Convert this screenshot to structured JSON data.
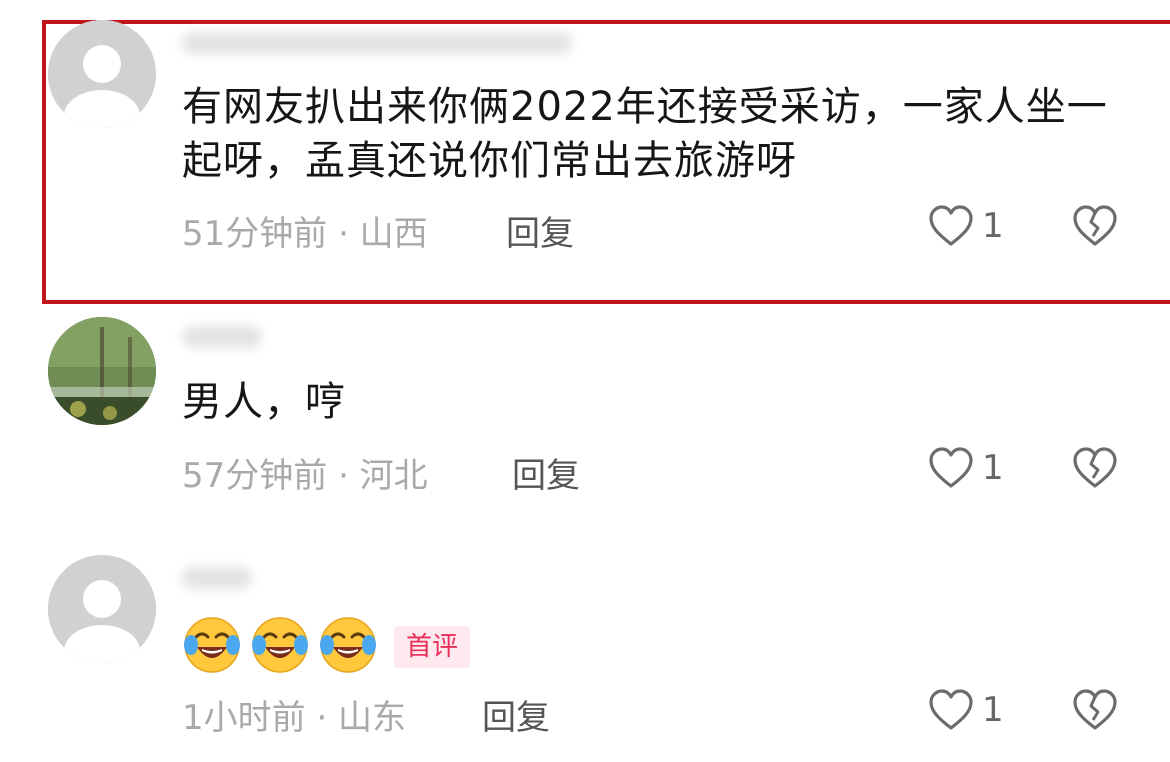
{
  "comments": [
    {
      "text": "有网友扒出来你俩2022年还接受采访，一家人坐一起呀，孟真还说你们常出去旅游呀",
      "time_location": "51分钟前 · 山西",
      "reply_label": "回复",
      "likes": "1",
      "avatar_icon": "default-avatar-icon"
    },
    {
      "text": "男人，哼",
      "time_location": "57分钟前 · 河北",
      "reply_label": "回复",
      "likes": "1",
      "avatar_icon": "photo-avatar"
    },
    {
      "emojis": [
        "face-with-tears-of-joy-emoji",
        "face-with-tears-of-joy-emoji",
        "face-with-tears-of-joy-emoji"
      ],
      "badge": "首评",
      "time_location": "1小时前 · 山东",
      "reply_label": "回复",
      "likes": "1",
      "avatar_icon": "default-avatar-icon"
    }
  ],
  "colors": {
    "highlight_border": "#c0161a",
    "meta_text": "#a9a9a9",
    "badge_text": "#ea2f58",
    "badge_bg": "#fde9ee"
  }
}
